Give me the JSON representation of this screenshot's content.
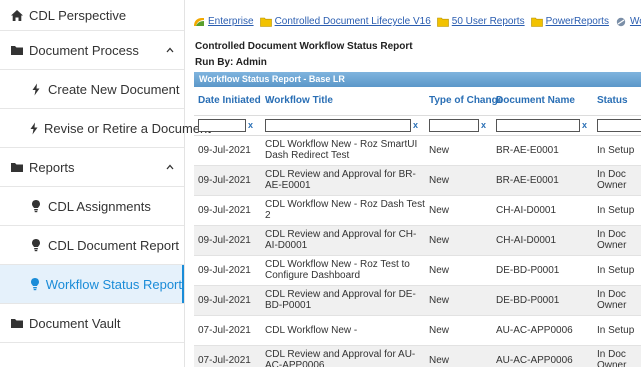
{
  "sidebar": {
    "items": [
      {
        "label": "CDL Perspective",
        "icon": "home-icon"
      },
      {
        "label": "Document Process",
        "icon": "folder-icon",
        "expanded": true
      },
      {
        "label": "Create New Document",
        "icon": "bolt-icon"
      },
      {
        "label": "Revise or Retire a Document",
        "icon": "bolt-icon"
      },
      {
        "label": "Reports",
        "icon": "folder-icon",
        "expanded": true
      },
      {
        "label": "CDL Assignments",
        "icon": "lightbulb-icon"
      },
      {
        "label": "CDL Document Report",
        "icon": "lightbulb-icon"
      },
      {
        "label": "Workflow Status Report",
        "icon": "lightbulb-icon",
        "active": true
      },
      {
        "label": "Document Vault",
        "icon": "folder-icon"
      }
    ]
  },
  "breadcrumb": [
    {
      "label": "Enterprise",
      "icon": "enterprise-icon"
    },
    {
      "label": "Controlled Document Lifecycle V16",
      "icon": "folder-icon"
    },
    {
      "label": "50 User Reports",
      "icon": "folder-icon"
    },
    {
      "label": "PowerReports",
      "icon": "folder-icon"
    },
    {
      "label": "Work Status Report PR",
      "icon": "report-icon"
    }
  ],
  "report": {
    "title": "Controlled Document Workflow Status Report",
    "run_by": "Run By: Admin",
    "grid_title": "Workflow Status Report - Base LR"
  },
  "table": {
    "columns": [
      "Date Initiated",
      "Workflow Title",
      "Type of Change",
      "Document Name",
      "Status"
    ],
    "sort_indicator": "↓",
    "filter_clear": "x",
    "rows": [
      [
        "09-Jul-2021",
        "CDL Workflow New - Roz SmartUI Dash Redirect Test",
        "New",
        "BR-AE-E0001",
        "In Setup"
      ],
      [
        "09-Jul-2021",
        "CDL Review and Approval for BR-AE-E0001",
        "New",
        "BR-AE-E0001",
        "In Doc Owner"
      ],
      [
        "09-Jul-2021",
        "CDL Workflow New - Roz Dash Test 2",
        "New",
        "CH-AI-D0001",
        "In Setup"
      ],
      [
        "09-Jul-2021",
        "CDL Review and Approval for CH-AI-D0001",
        "New",
        "CH-AI-D0001",
        "In Doc Owner"
      ],
      [
        "09-Jul-2021",
        "CDL Workflow New - Roz Test to Configure Dashboard",
        "New",
        "DE-BD-P0001",
        "In Setup"
      ],
      [
        "09-Jul-2021",
        "CDL Review and Approval for DE-BD-P0001",
        "New",
        "DE-BD-P0001",
        "In Doc Owner"
      ],
      [
        "07-Jul-2021",
        "CDL Workflow New -",
        "New",
        "AU-AC-APP0006",
        "In Setup"
      ],
      [
        "07-Jul-2021",
        "CDL Review and Approval for AU-AC-APP0006",
        "New",
        "AU-AC-APP0006",
        "In Doc Owner"
      ]
    ]
  },
  "colors": {
    "accent": "#1a8cd8",
    "link": "#2a5db0",
    "header_text": "#2a6fb5",
    "grid_header": "#6aa6d6",
    "folder": "#f2c200"
  }
}
